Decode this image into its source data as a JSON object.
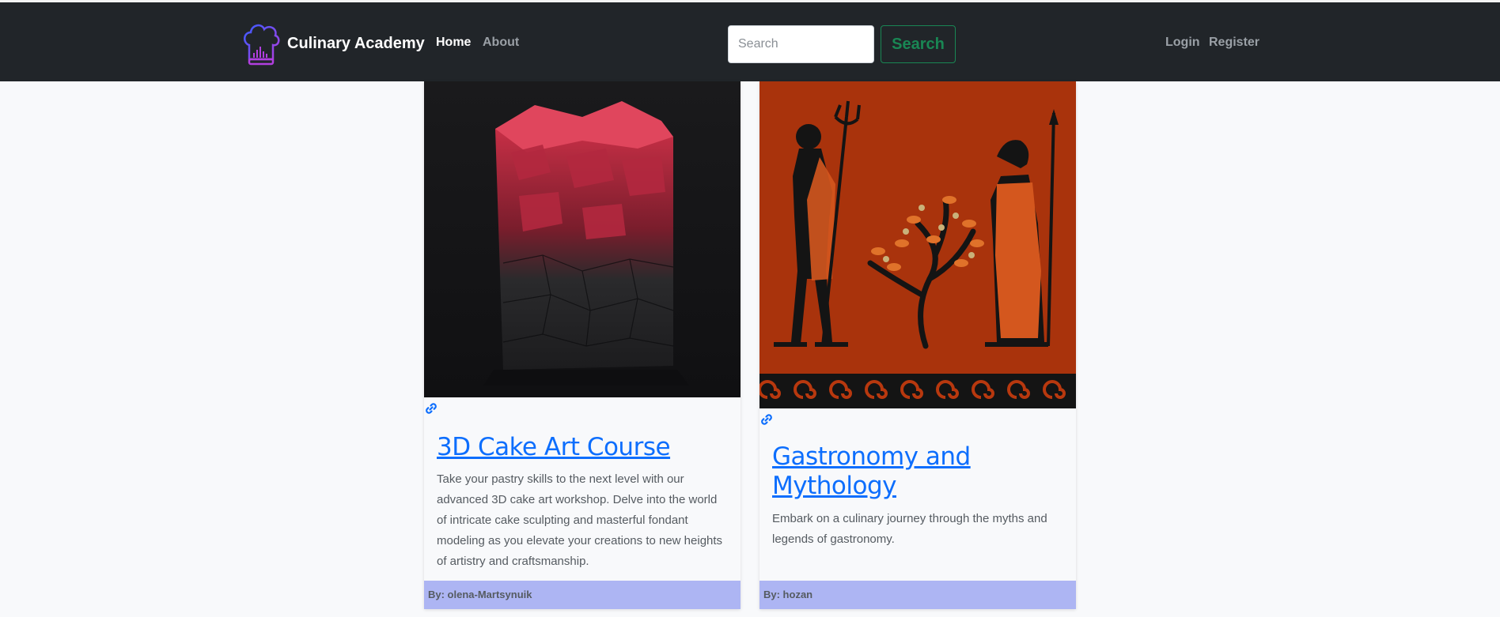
{
  "nav": {
    "brand": "Culinary Academy",
    "links": {
      "home": "Home",
      "about": "About"
    },
    "search": {
      "placeholder": "Search",
      "button": "Search"
    },
    "auth": {
      "login": "Login",
      "register": "Register"
    }
  },
  "cards": [
    {
      "title": "3D Cake Art Course",
      "description": "Take your pastry skills to the next level with our advanced 3D cake art workshop. Delve into the world of intricate cake sculpting and masterful fondant modeling as you elevate your creations to new heights of artistry and craftsmanship.",
      "author": "By: olena-Martsynuik"
    },
    {
      "title": "Gastronomy and Mythology",
      "description": "Embark on a culinary journey through the myths and legends of gastronomy.",
      "author": "By: hozan"
    }
  ],
  "colors": {
    "navbar": "#212529",
    "link": "#0d6efd",
    "search_outline": "#198754",
    "card_footer": "#adb5f3",
    "logo": "#6f42c1"
  },
  "icons": [
    "chef-hat-logo",
    "link-icon"
  ]
}
